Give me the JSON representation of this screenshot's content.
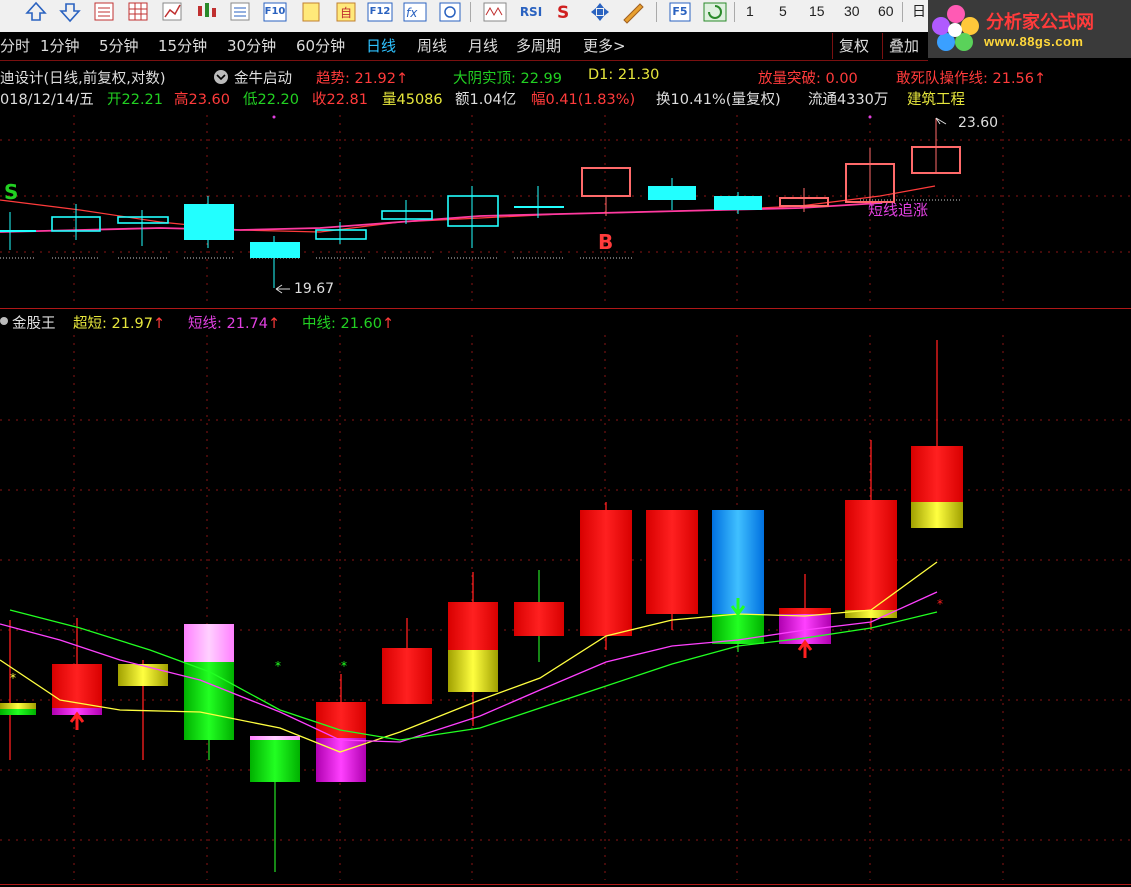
{
  "toolbar": {
    "icons": [
      "arrow-up-icon",
      "arrow-down-icon",
      "calc-icon",
      "grid-icon",
      "line-chart-icon",
      "candle-icon",
      "list-icon",
      "f10-icon",
      "doc-icon",
      "self-icon",
      "f12-icon",
      "formula-icon",
      "circle-icon",
      "wave-icon",
      "rsi-icon",
      "s-icon",
      "move-icon",
      "pen-icon",
      "f5-icon",
      "refresh-icon"
    ],
    "f10_label": "F10",
    "f12_label": "F12",
    "rsi_label": "RSI",
    "f5_label": "F5",
    "numbers": [
      "1",
      "5",
      "15",
      "30",
      "60"
    ],
    "day_label": "日"
  },
  "logo": {
    "title": "分析家公式网",
    "url": "www.88gs.com"
  },
  "periods": [
    "分时",
    "1分钟",
    "5分钟",
    "15分钟",
    "30分钟",
    "60分钟",
    "日线",
    "周线",
    "月线",
    "多周期",
    "更多>"
  ],
  "active_period": "日线",
  "right_buttons": [
    "复权",
    "叠加"
  ],
  "info1": {
    "name": "迪设计(日线,前复权,对数)",
    "indicator": "金牛启动",
    "trend_label": "趋势: 21.92",
    "yin_label": "大阴实顶: 22.99",
    "d1_label": "D1: 21.30",
    "volume_label": "放量突破: 0.00",
    "dare_label": "敢死队操作线: 21.56"
  },
  "info2": {
    "date": "018/12/14/五",
    "open": "开22.21",
    "high": "高23.60",
    "low": "低22.20",
    "close": "收22.81",
    "vol": "量45086",
    "amount": "额1.04亿",
    "amp": "幅0.41(1.83%)",
    "turn": "换10.41%(量复权)",
    "float": "流通4330万",
    "sector": "建筑工程"
  },
  "main_chart": {
    "max_label": "23.60",
    "min_label": "19.67",
    "signal_s": "S",
    "signal_b": "B",
    "note": "短线追涨"
  },
  "sub_header": {
    "name": "金股王",
    "ultra_label": "超短: 21.97",
    "short_label": "短线: 21.74",
    "mid_label": "中线: 21.60"
  },
  "colors": {
    "red": "#ff3b3b",
    "green": "#22d022",
    "yellow": "#e6e63c",
    "magenta": "#e040e0",
    "cyan": "#22ffff",
    "bg": "#000000",
    "grid": "#b01818"
  }
}
